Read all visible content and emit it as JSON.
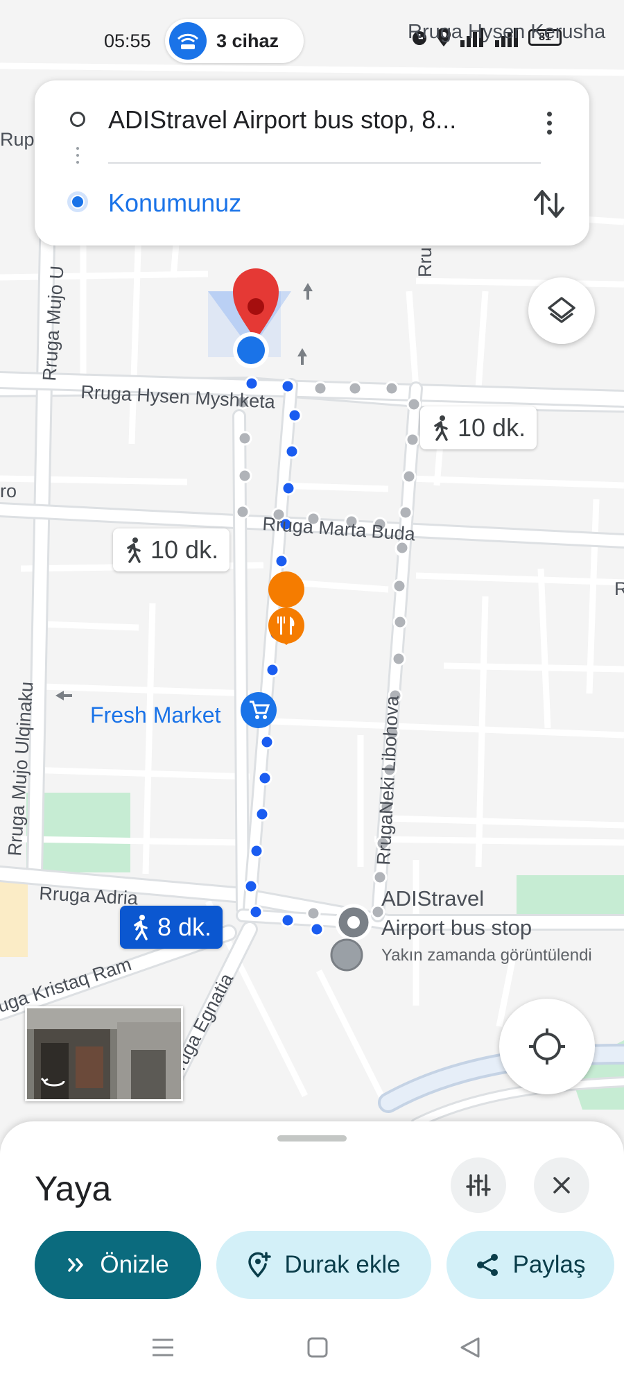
{
  "status_bar": {
    "time": "05:55",
    "hotspot_label": "3 cihaz",
    "battery": "81"
  },
  "directions": {
    "origin": "ADIStravel Airport bus stop, 8...",
    "destination": "Konumunuz"
  },
  "map": {
    "streets": {
      "hysen_myshketa": "Rruga Hysen Myshketa",
      "hysen_kerusha": "Rruga Hysen Kerusha",
      "marta_buda": "Rruga Marta Buda",
      "mujo_u": "Rruga Mujo U",
      "mujo_ulqinaku": "Rruga Mujo Ulqinaku",
      "neki_libohova": "RrugaNeki Libohova",
      "adria": "Rruga Adria",
      "kristaq_rama": "uga Kristaq Ram",
      "egnatia": "ruga Egnatia",
      "rup": "Rup",
      "rru": "Rru",
      "ro": "ro",
      "r": "R"
    },
    "places": {
      "fresh_market": "Fresh Market",
      "bus_stop_line1": "ADIStravel",
      "bus_stop_line2": "Airport bus stop",
      "bus_stop_note": "Yakın zamanda görüntülendi"
    },
    "route_times": {
      "right": "10 dk.",
      "left": "10 dk.",
      "selected": "8 dk."
    }
  },
  "bottom_sheet": {
    "mode": "Yaya",
    "preview": "Önizle",
    "add_stop": "Durak ekle",
    "share": "Paylaş"
  },
  "colors": {
    "route_selected": "#1a5cf0",
    "route_alt": "#b0b3b8",
    "pin": "#e53935",
    "primary_button": "#0b6b7e",
    "secondary_button": "#d3f0f8"
  }
}
